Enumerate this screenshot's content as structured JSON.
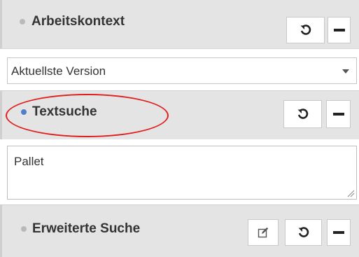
{
  "panels": {
    "context": {
      "title": "Arbeitskontext",
      "select_value": "Aktuellste Version"
    },
    "text_search": {
      "title": "Textsuche",
      "input_value": "Pallet"
    },
    "advanced_search": {
      "title": "Erweiterte Suche"
    }
  },
  "icons": {
    "reset": "reset-icon",
    "collapse": "minus-icon",
    "edit": "edit-icon",
    "dropdown": "caret-down-icon",
    "resize": "resize-grip-icon"
  },
  "colors": {
    "panel_background": "#e4e4e4",
    "active_dot": "#4f7fc6",
    "inactive_dot": "#b9b9b9",
    "highlight_ellipse": "#e01f1f"
  }
}
